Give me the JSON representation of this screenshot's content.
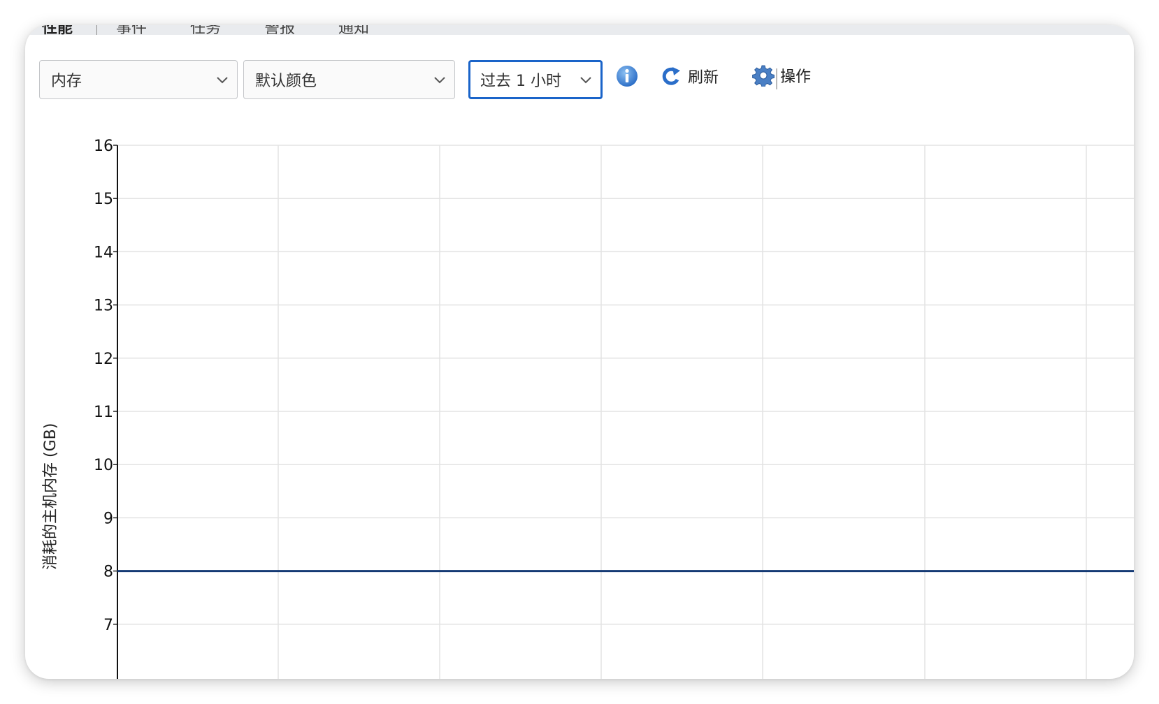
{
  "tabs": [
    "性能",
    "事件",
    "任务",
    "警报",
    "通知"
  ],
  "controls": {
    "metric_select": "内存",
    "color_select": "默认颜色",
    "time_select": "过去 1 小时",
    "refresh_label": "刷新",
    "actions_label": "操作"
  },
  "colors": {
    "accent": "#1a64c9",
    "series_line": "#153a74",
    "grid": "#e3e3e3",
    "info_icon": "#3f86db"
  },
  "chart_data": {
    "type": "line",
    "ylabel": "消耗的主机内存 (GB)",
    "yticks": [
      16,
      15,
      14,
      13,
      12,
      11,
      10,
      9,
      8,
      7
    ],
    "ylim": [
      7,
      16
    ],
    "grid": true,
    "series": [
      {
        "values": [
          8,
          8,
          8,
          8,
          8,
          8,
          8
        ]
      }
    ]
  }
}
